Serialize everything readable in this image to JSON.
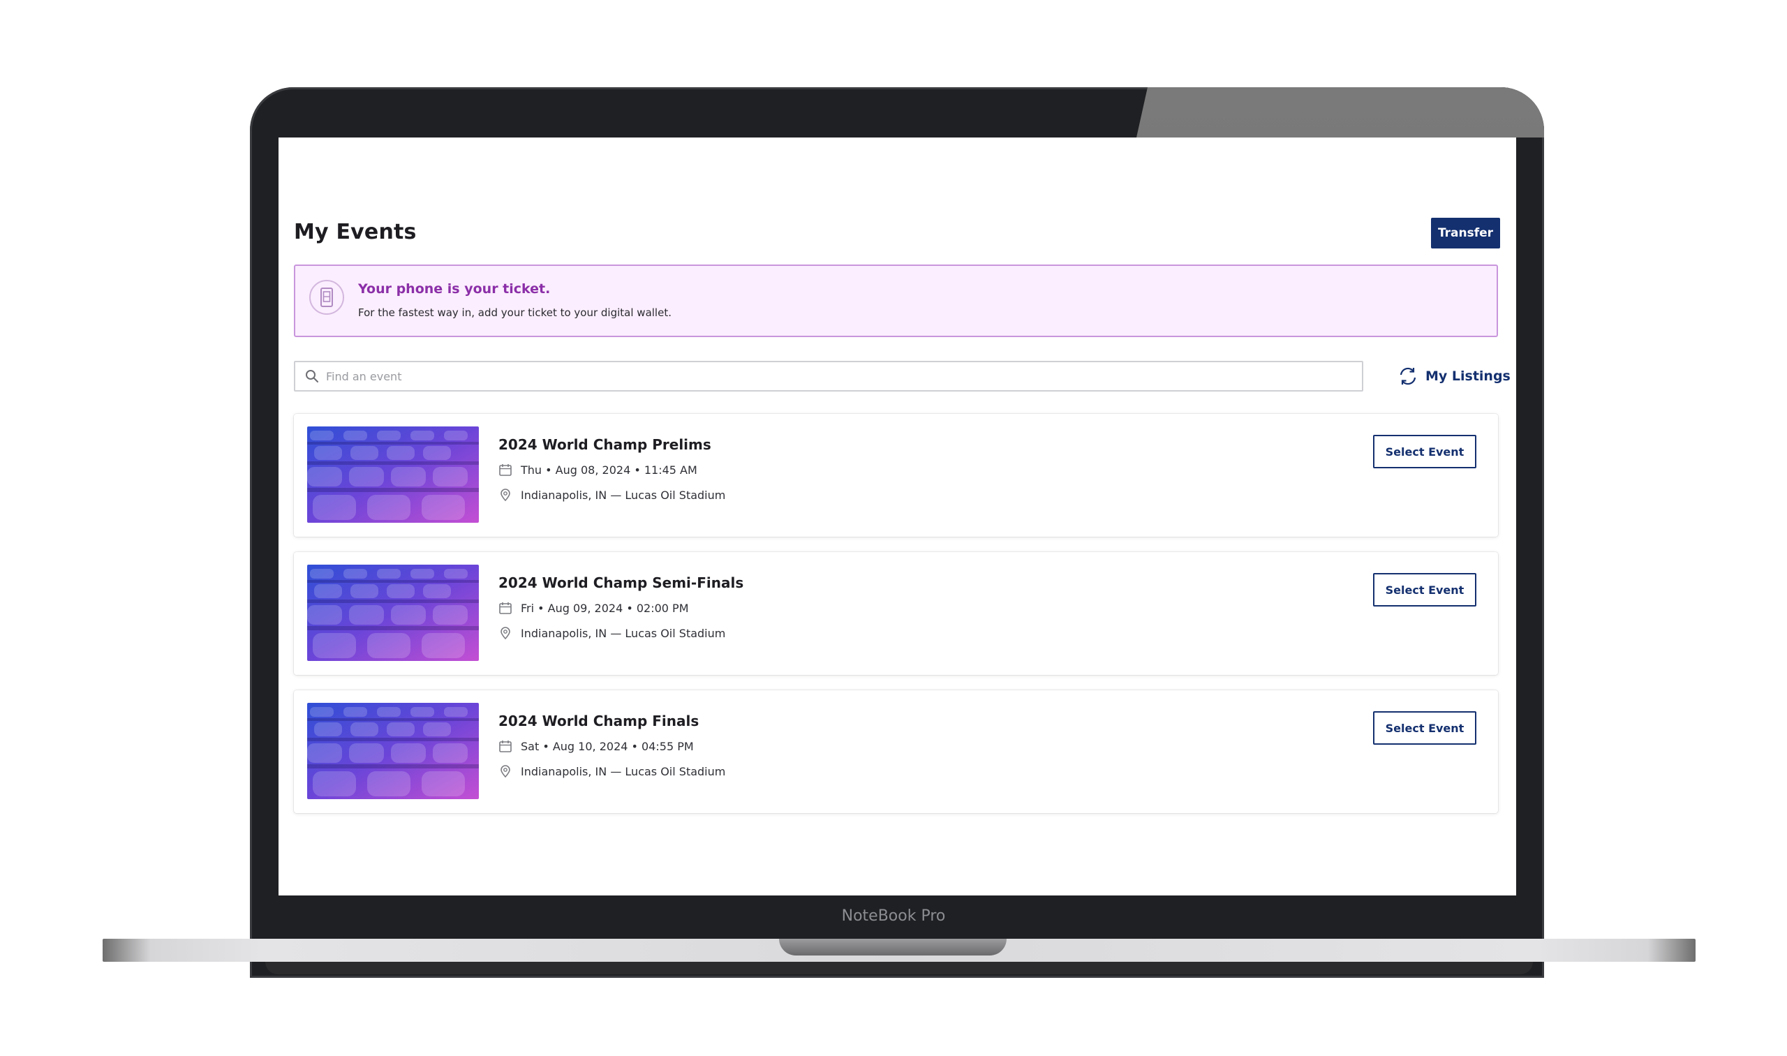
{
  "device": {
    "brand_label": "NoteBook Pro"
  },
  "header": {
    "title": "My Events",
    "transfer_label": "Transfer"
  },
  "banner": {
    "title": "Your phone is your ticket.",
    "subtitle": "For the fastest way in, add your ticket to your digital wallet.",
    "icon": "phone-ticket-icon"
  },
  "search": {
    "placeholder": "Find an event",
    "value": ""
  },
  "listings_link": {
    "label": "My Listings",
    "icon": "refresh-icon"
  },
  "events": [
    {
      "title": "2024 World Champ Prelims",
      "date": "Thu • Aug 08, 2024 • 11:45 AM",
      "venue": "Indianapolis, IN — Lucas Oil Stadium",
      "button_label": "Select Event"
    },
    {
      "title": "2024 World Champ Semi-Finals",
      "date": "Fri • Aug 09, 2024 • 02:00 PM",
      "venue": "Indianapolis, IN — Lucas Oil Stadium",
      "button_label": "Select Event"
    },
    {
      "title": "2024 World Champ Finals",
      "date": "Sat • Aug 10, 2024 • 04:55 PM",
      "venue": "Indianapolis, IN — Lucas Oil Stadium",
      "button_label": "Select Event"
    }
  ],
  "colors": {
    "primary": "#14306f",
    "banner_bg": "#fbeefe",
    "banner_border": "#c996dd",
    "banner_title": "#8b2fa8"
  }
}
